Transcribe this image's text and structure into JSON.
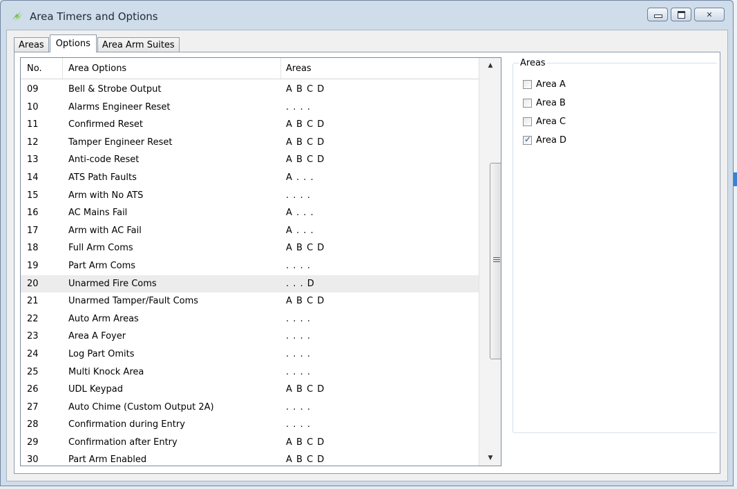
{
  "window": {
    "title": "Area Timers and Options"
  },
  "tabs": [
    {
      "label": "Areas"
    },
    {
      "label": "Options"
    },
    {
      "label": "Area Arm Suites"
    }
  ],
  "list": {
    "columns": {
      "no": "No.",
      "name": "Area Options",
      "areas": "Areas"
    },
    "rows": [
      {
        "no": "09",
        "name": "Bell & Strobe Output",
        "areas": "A B C D"
      },
      {
        "no": "10",
        "name": "Alarms Engineer Reset",
        "areas": ". . . ."
      },
      {
        "no": "11",
        "name": "Confirmed Reset",
        "areas": "A B C D"
      },
      {
        "no": "12",
        "name": "Tamper Engineer Reset",
        "areas": "A B C D"
      },
      {
        "no": "13",
        "name": "Anti-code Reset",
        "areas": "A B C D"
      },
      {
        "no": "14",
        "name": "ATS Path Faults",
        "areas": "A . . ."
      },
      {
        "no": "15",
        "name": "Arm with No ATS",
        "areas": ". . . ."
      },
      {
        "no": "16",
        "name": "AC Mains Fail",
        "areas": "A . . ."
      },
      {
        "no": "17",
        "name": "Arm with AC Fail",
        "areas": "A . . ."
      },
      {
        "no": "18",
        "name": "Full Arm Coms",
        "areas": "A B C D"
      },
      {
        "no": "19",
        "name": "Part Arm Coms",
        "areas": ". . . ."
      },
      {
        "no": "20",
        "name": "Unarmed Fire Coms",
        "areas": ". . . D"
      },
      {
        "no": "21",
        "name": "Unarmed Tamper/Fault Coms",
        "areas": "A B C D"
      },
      {
        "no": "22",
        "name": "Auto Arm Areas",
        "areas": ". . . ."
      },
      {
        "no": "23",
        "name": "Area A Foyer",
        "areas": ". . . ."
      },
      {
        "no": "24",
        "name": "Log Part Omits",
        "areas": ". . . ."
      },
      {
        "no": "25",
        "name": "Multi Knock Area",
        "areas": ". . . ."
      },
      {
        "no": "26",
        "name": "UDL Keypad",
        "areas": "A B C D"
      },
      {
        "no": "27",
        "name": "Auto Chime (Custom Output 2A)",
        "areas": ". . . ."
      },
      {
        "no": "28",
        "name": "Confirmation during Entry",
        "areas": ". . . ."
      },
      {
        "no": "29",
        "name": "Confirmation after Entry",
        "areas": "A B C D"
      },
      {
        "no": "30",
        "name": "Part Arm Enabled",
        "areas": "A B C D"
      }
    ],
    "selected_no": "20"
  },
  "areas_group": {
    "legend": "Areas",
    "items": [
      {
        "label": "Area A",
        "checked": false
      },
      {
        "label": "Area B",
        "checked": false
      },
      {
        "label": "Area C",
        "checked": false
      },
      {
        "label": "Area D",
        "checked": true
      }
    ]
  },
  "colors": {
    "accent": "#3c7fd1",
    "titlebar": "#cfdcea",
    "selected_row": "#ececec"
  },
  "icons": {
    "app": "lightning-app-icon",
    "check": "check-mark-icon"
  }
}
